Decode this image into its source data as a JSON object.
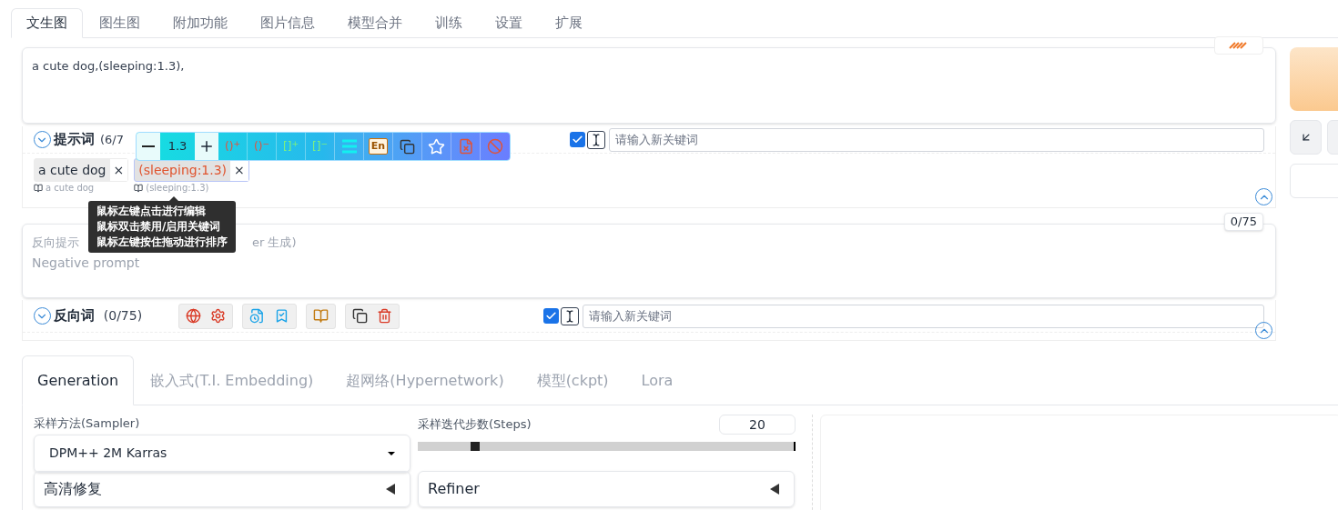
{
  "tabs": [
    {
      "label": "文生图",
      "selected": true
    },
    {
      "label": "图生图",
      "selected": false
    },
    {
      "label": "附加功能",
      "selected": false
    },
    {
      "label": "图片信息",
      "selected": false
    },
    {
      "label": "模型合并",
      "selected": false
    },
    {
      "label": "训练",
      "selected": false
    },
    {
      "label": "设置",
      "selected": false
    },
    {
      "label": "扩展",
      "selected": false
    }
  ],
  "prompt": {
    "value": "a cute dog,(sleeping:1.3),"
  },
  "prompt_tools": {
    "title": "提示词",
    "count": "(6/7",
    "auto_checked": true,
    "keyword_placeholder": "请输入新关键词",
    "tags": [
      {
        "text": "a cute dog",
        "close": "×",
        "translation": "a cute dog",
        "selected": false
      },
      {
        "text": "(sleeping:1.3)",
        "close": "×",
        "translation": "(sleeping:1.3)",
        "selected": true
      }
    ]
  },
  "tag_toolbar": {
    "value": "1.3",
    "bracket_buttons": [
      "()$^{+}$",
      "()$^{−}$",
      "[]$^{+}$",
      "[]$^{−}$"
    ],
    "en_label": "En"
  },
  "tooltip": [
    "鼠标左键点击进行编辑",
    "鼠标双击禁用/启用关键词",
    "鼠标左键按住拖动进行排序"
  ],
  "negative": {
    "placeholder_start": "反向提示",
    "placeholder_end": "er 生成)",
    "placeholder_line2": "Negative prompt",
    "counter": "0/75"
  },
  "negative_tools": {
    "title": "反向词",
    "count": "(0/75)",
    "auto_checked": true,
    "keyword_placeholder": "请输入新关键词"
  },
  "sub_tabs": [
    {
      "label": "Generation",
      "selected": true
    },
    {
      "label": "嵌入式(T.I. Embedding)",
      "selected": false
    },
    {
      "label": "超网络(Hypernetwork)",
      "selected": false
    },
    {
      "label": "模型(ckpt)",
      "selected": false
    },
    {
      "label": "Lora",
      "selected": false
    }
  ],
  "sampler": {
    "label": "采样方法(Sampler)",
    "value": "DPM++ 2M Karras"
  },
  "steps": {
    "label": "采样迭代步数(Steps)",
    "value": "20",
    "level": 0.14
  },
  "accordions": [
    {
      "label": "高清修复",
      "expanded": false
    },
    {
      "label": "Refiner",
      "expanded": false
    }
  ]
}
